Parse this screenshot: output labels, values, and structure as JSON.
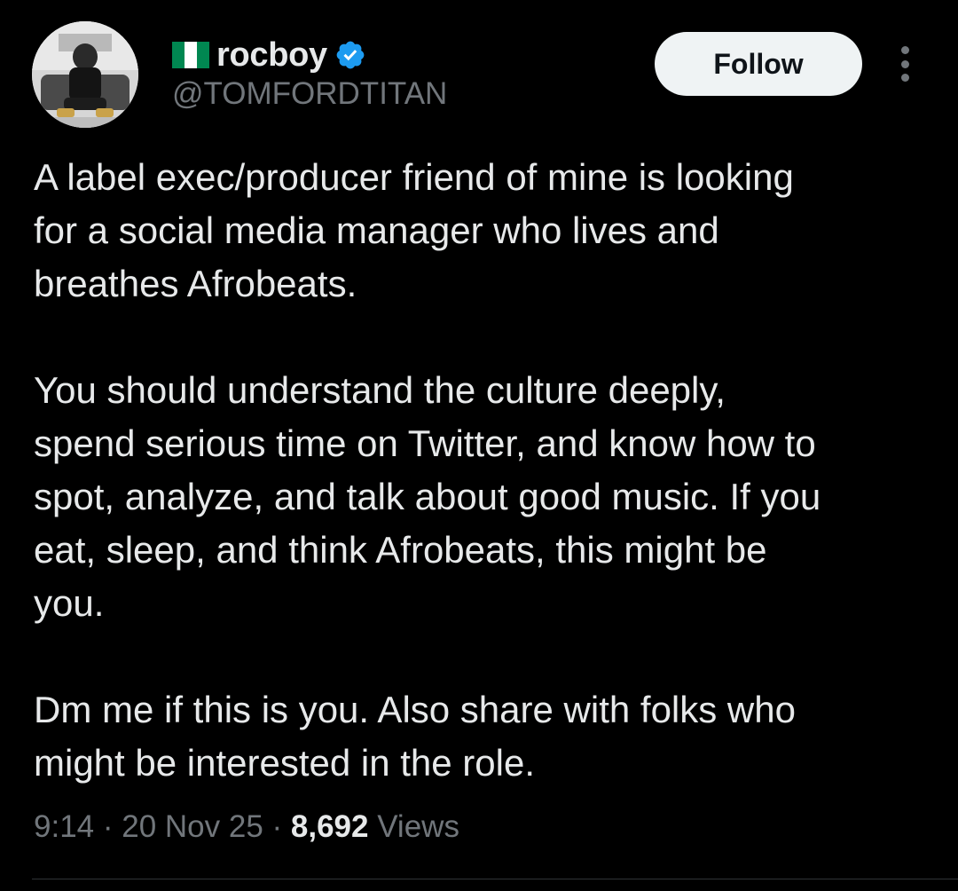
{
  "author": {
    "flag_icon": "nigeria-flag-icon",
    "display_name": "rocboy",
    "verified_icon": "verified-badge-icon",
    "handle": "@TOMFORDTITAN",
    "avatar_icon": "profile-avatar"
  },
  "actions": {
    "follow_label": "Follow",
    "more_icon": "more-options-icon"
  },
  "tweet": {
    "paragraphs": [
      "A label exec/producer friend of mine is looking\nfor a social media manager who lives and\nbreathes Afrobeats.",
      "You should understand the culture deeply,\nspend serious time on Twitter, and know how to\nspot, analyze, and talk about good music. If you\neat, sleep, and think Afrobeats, this might be\nyou.",
      "Dm me if this is you. Also share with folks who\nmight be interested in the role."
    ]
  },
  "meta": {
    "time": "9:14",
    "separator": " · ",
    "date": "20 Nov 25",
    "views_count": "8,692",
    "views_label": " Views"
  },
  "colors": {
    "background": "#000000",
    "text_primary": "#e7e9ea",
    "text_secondary": "#71767b",
    "verified_blue": "#1d9bf0",
    "follow_bg": "#eff3f4",
    "divider": "#2f3336"
  }
}
